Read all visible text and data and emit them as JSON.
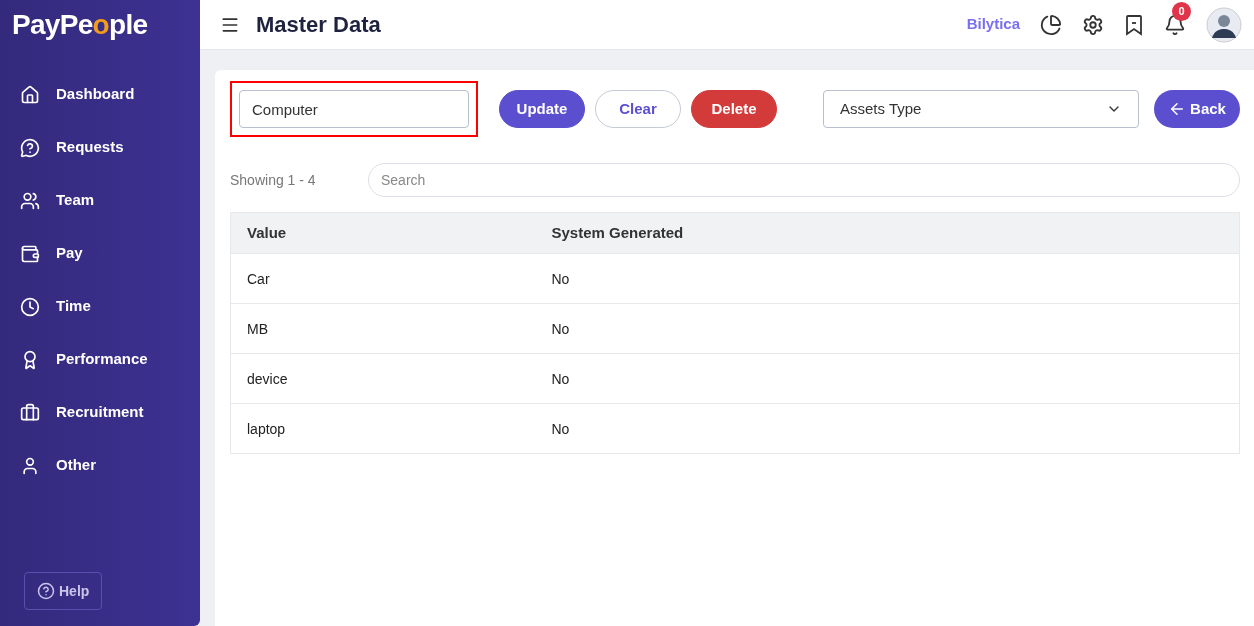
{
  "logo": {
    "before": "PayPe",
    "accent": "o",
    "after": "ple"
  },
  "sidebar": {
    "items": [
      {
        "label": "Dashboard",
        "kind": "home"
      },
      {
        "label": "Requests",
        "kind": "requests"
      },
      {
        "label": "Team",
        "kind": "team"
      },
      {
        "label": "Pay",
        "kind": "wallet"
      },
      {
        "label": "Time",
        "kind": "clock"
      },
      {
        "label": "Performance",
        "kind": "award"
      },
      {
        "label": "Recruitment",
        "kind": "briefcase"
      },
      {
        "label": "Other",
        "kind": "user"
      }
    ],
    "help": "Help"
  },
  "header": {
    "title": "Master Data",
    "company": "Bilytica",
    "notifications": "0"
  },
  "form": {
    "value": "Computer",
    "highlighted": true,
    "buttons": [
      {
        "label": "Update",
        "kind": "primary"
      },
      {
        "label": "Clear",
        "kind": "outline"
      },
      {
        "label": "Delete",
        "kind": "danger"
      }
    ],
    "type_select": "Assets Type",
    "back": "Back"
  },
  "list": {
    "showing": "Showing 1 - 4",
    "search_placeholder": "Search"
  },
  "table": {
    "columns": [
      "Value",
      "System Generated"
    ],
    "rows": [
      [
        "Car",
        "No"
      ],
      [
        "MB",
        "No"
      ],
      [
        "device",
        "No"
      ],
      [
        "laptop",
        "No"
      ]
    ]
  }
}
